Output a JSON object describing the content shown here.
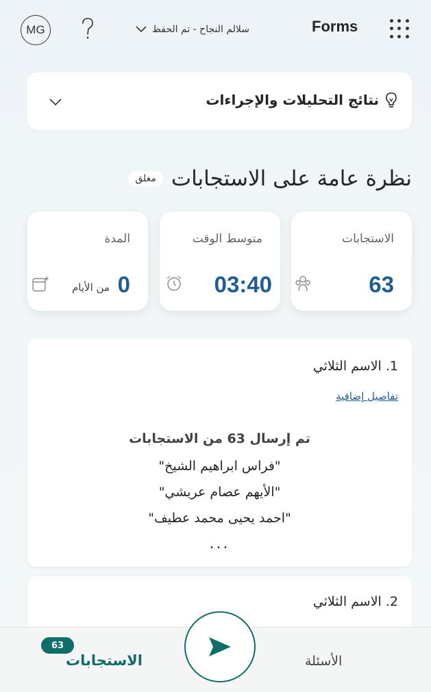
{
  "topbar": {
    "avatar": "MG",
    "doc_title": "سلالم النجاح  -  تم الحفظ",
    "brand": "Forms",
    "icons": [
      "waffle-icon",
      "help-icon",
      "chevron-down-icon"
    ]
  },
  "insights": {
    "label": "نتائج التحليلات والإجراءات",
    "icon": "lightbulb-icon"
  },
  "overview": {
    "title": "نظرة عامة على الاستجابات",
    "status": "مغلق"
  },
  "stats": {
    "responses": {
      "label": "الاستجابات",
      "value": "63",
      "icon": "people-icon"
    },
    "avg_time": {
      "label": "متوسط الوقت",
      "value": "03:40",
      "icon": "alarm-clock-icon"
    },
    "duration": {
      "label": "المدة",
      "value": "0",
      "unit": "من الأيام",
      "icon": "calendar-sparkle-icon"
    }
  },
  "questions": [
    {
      "title": "1. الاسم الثلاثي",
      "link": "تفاصيل إضافية",
      "summary": "تم إرسال 63 من الاستجابات",
      "answers": [
        "\"فراس ابراهيم الشيخ\"",
        "\"الأيهم عصام عريشي\"",
        "\"احمد يحيى محمد عطيف\""
      ],
      "more": "..."
    },
    {
      "title": "2. الاسم الثلاثي"
    }
  ],
  "bottombar": {
    "questions_tab": "الأسئلة",
    "responses_tab": "الاستجابات",
    "responses_badge": "63"
  },
  "colors": {
    "accent_teal": "#0f6d6a",
    "value_blue": "#1f5d95"
  }
}
